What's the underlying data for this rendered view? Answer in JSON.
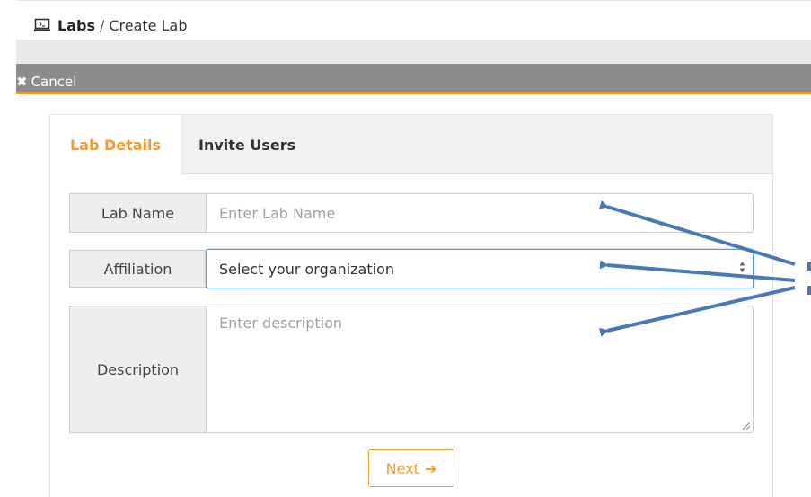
{
  "breadcrumb": {
    "root": "Labs",
    "separator": "/",
    "current": "Create Lab",
    "icon": "monitor-icon"
  },
  "cancel_bar": {
    "label": "Cancel",
    "icon": "close-icon"
  },
  "tabs": [
    {
      "label": "Lab Details",
      "active": true
    },
    {
      "label": "Invite Users",
      "active": false
    }
  ],
  "form": {
    "lab_name": {
      "label": "Lab Name",
      "placeholder": "Enter Lab Name",
      "value": ""
    },
    "affiliation": {
      "label": "Affiliation",
      "value": "Select your organization"
    },
    "description": {
      "label": "Description",
      "placeholder": "Enter description",
      "value": ""
    }
  },
  "next_button": {
    "label": "Next",
    "icon": "arrow-right-icon"
  },
  "colors": {
    "accent": "#f29b32",
    "cancel_bar": "#8c8c8c",
    "annotation_arrow": "#4a7ab5",
    "focus": "#5b9bd5"
  }
}
